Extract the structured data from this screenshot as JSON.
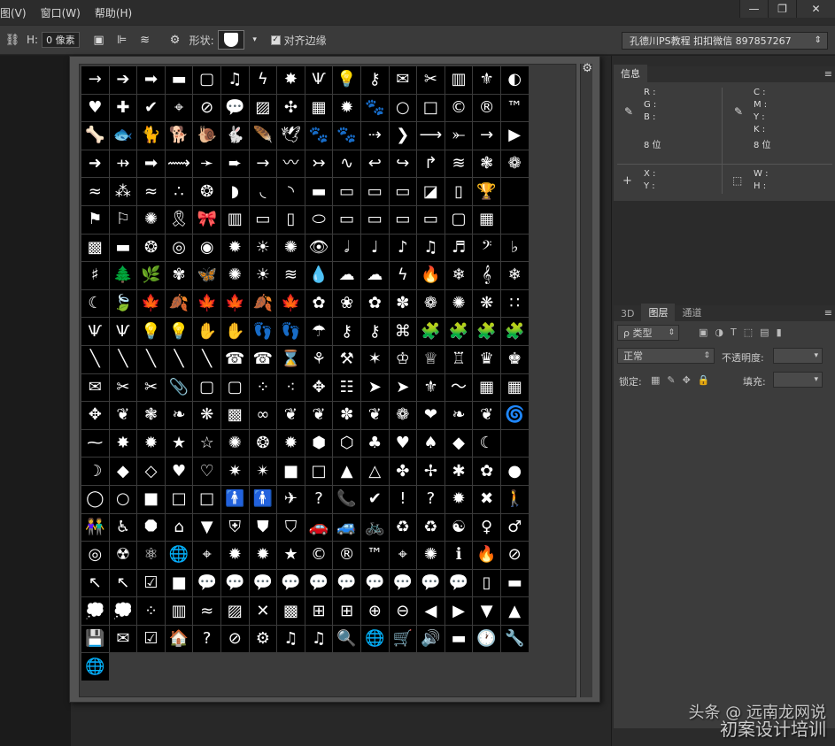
{
  "menu": [
    "图(V)",
    "窗口(W)",
    "帮助(H)"
  ],
  "window_controls": [
    "—",
    "❐",
    "✕"
  ],
  "options": {
    "h_label": "H:",
    "h_value": "0 像素",
    "shape_label": "形状:",
    "align_edges_label": "对齐边缘",
    "preset": "孔德川PS教程 扣扣微信 897857267"
  },
  "shapes": [
    "→",
    "➔",
    "➡",
    "▬",
    "▢",
    "♫",
    "ϟ",
    "✸",
    "Ѱ",
    "💡",
    "⚷",
    "✉",
    "✂",
    "▥",
    "⚜",
    "◐",
    "♥",
    "✚",
    "✔",
    "⌖",
    "⊘",
    "💬",
    "▨",
    "✣",
    "▦",
    "✹",
    "🐾",
    "○",
    "□",
    "©",
    "®",
    "™",
    "🦴",
    "🐟",
    "🐈",
    "🐕",
    "🐌",
    "🐇",
    "🪶",
    "🕊",
    "🐾",
    "🐾",
    "⇢",
    "❯",
    "⟶",
    "⤜",
    "→",
    "▶",
    "➜",
    "⇸",
    "➡",
    "⟿",
    "➛",
    "➨",
    "→",
    "〰",
    "↣",
    "∿",
    "↩",
    "↪",
    "↱",
    "≋",
    "❃",
    "❁",
    "≈",
    "⁂",
    "≈",
    "∴",
    "❂",
    "◗",
    "◟",
    "◝",
    "▬",
    "▭",
    "▭",
    "▭",
    "◪",
    "▯",
    "🏆",
    "",
    "⚑",
    "⚐",
    "✺",
    "🎗",
    "🎀",
    "▥",
    "▭",
    "▯",
    "⬭",
    "▭",
    "▭",
    "▭",
    "▭",
    "▢",
    "▦",
    "",
    "▩",
    "▬",
    "❂",
    "◎",
    "◉",
    "✹",
    "☀",
    "✺",
    "👁",
    "𝅗𝅥",
    "♩",
    "♪",
    "♫",
    "♬",
    "𝄢",
    "♭",
    "♯",
    "🌲",
    "🌿",
    "✾",
    "🦋",
    "✺",
    "☀",
    "≋",
    "💧",
    "☁",
    "☁",
    "ϟ",
    "🔥",
    "❄",
    "𝄞",
    "❄",
    "☾",
    "🍃",
    "🍁",
    "🍂",
    "🍁",
    "🍁",
    "🍂",
    "🍁",
    "✿",
    "❀",
    "✿",
    "✽",
    "❁",
    "✺",
    "❋",
    "∷",
    "Ѱ",
    "Ѱ",
    "💡",
    "💡",
    "✋",
    "✋",
    "👣",
    "👣",
    "☂",
    "⚷",
    "⚷",
    "⌘",
    "🧩",
    "🧩",
    "🧩",
    "🧩",
    "╲",
    "╲",
    "╲",
    "╲",
    "╲",
    "☎",
    "☎",
    "⌛",
    "⚘",
    "⚒",
    "✶",
    "♔",
    "♕",
    "♖",
    "♛",
    "♚",
    "✉",
    "✂",
    "✂",
    "📎",
    "▢",
    "▢",
    "⁘",
    "⁖",
    "✥",
    "☷",
    "➤",
    "➤",
    "⚜",
    "～",
    "▦",
    "▦",
    "✥",
    "❦",
    "❃",
    "❧",
    "❋",
    "▩",
    "∞",
    "❦",
    "❦",
    "✽",
    "❦",
    "❁",
    "❤",
    "❧",
    "❦",
    "🌀",
    "⁓",
    "✸",
    "✹",
    "★",
    "☆",
    "✺",
    "❂",
    "✹",
    "⬢",
    "⬡",
    "♣",
    "♥",
    "♠",
    "◆",
    "☾",
    "",
    "☽",
    "◆",
    "◇",
    "♥",
    "♡",
    "✷",
    "✴",
    "■",
    "□",
    "▲",
    "△",
    "✤",
    "✢",
    "✱",
    "✿",
    "●",
    "◯",
    "○",
    "■",
    "□",
    "□",
    "🚹",
    "🚹",
    "✈",
    "?",
    "📞",
    "✔",
    "!",
    "?",
    "✹",
    "✖",
    "🚶",
    "👫",
    "♿",
    "⯃",
    "⌂",
    "▼",
    "⛨",
    "⛊",
    "⛉",
    "🚗",
    "🚙",
    "🚲",
    "♻",
    "♻",
    "☯",
    "♀",
    "♂",
    "◎",
    "☢",
    "⚛",
    "🌐",
    "⌖",
    "✹",
    "✹",
    "★",
    "©",
    "®",
    "™",
    "⌖",
    "✺",
    "ℹ",
    "🔥",
    "⊘",
    "↖",
    "↖",
    "☑",
    "■",
    "💬",
    "💬",
    "💬",
    "💬",
    "💬",
    "💬",
    "💬",
    "💬",
    "💬",
    "💬",
    "▯",
    "▬",
    "💭",
    "💭",
    "⁘",
    "▥",
    "≈",
    "▨",
    "✕",
    "▩",
    "⊞",
    "⊞",
    "⊕",
    "⊖",
    "◀",
    "▶",
    "▼",
    "▲",
    "💾",
    "✉",
    "☑",
    "🏠",
    "?",
    "⊘",
    "⚙",
    "♫",
    "♫",
    "🔍",
    "🌐",
    "🛒",
    "🔊",
    "▬",
    "🕐",
    "🔧",
    "🌐"
  ],
  "info_panel": {
    "tab": "信息",
    "left_rows": [
      "R :",
      "G :",
      "B :",
      "",
      "8 位"
    ],
    "right_rows": [
      "C :",
      "M :",
      "Y :",
      "K :",
      "8 位"
    ],
    "xy_rows": [
      "X :",
      "Y :"
    ],
    "wh_rows": [
      "W :",
      "H :"
    ]
  },
  "layers_panel": {
    "tabs": [
      "3D",
      "图层",
      "通道"
    ],
    "filter_label": "ρ 类型",
    "blend_mode": "正常",
    "opacity_label": "不透明度:",
    "lock_label": "锁定:",
    "fill_label": "填充:"
  },
  "watermark": {
    "line1": "头条 @ 远南龙网说",
    "line2": "初案设计培训"
  }
}
